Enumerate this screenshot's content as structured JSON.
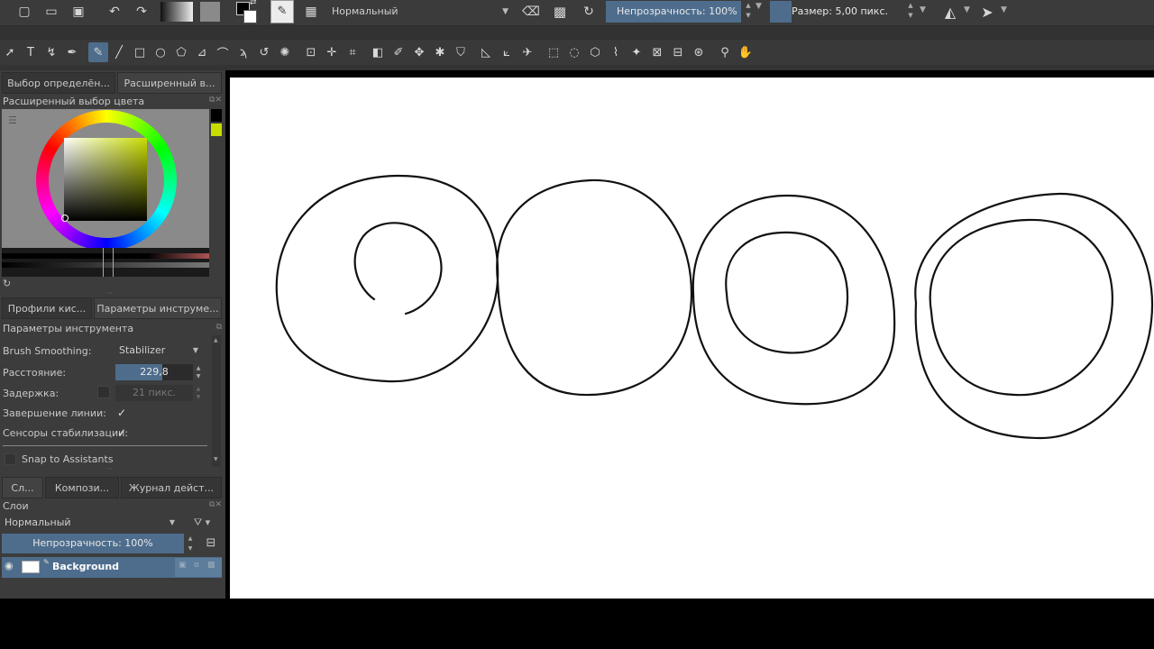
{
  "toolbar": {
    "blend_mode": "Нормальный",
    "opacity": "Непрозрачность: 100%",
    "size": "Размер: 5,00 пикс."
  },
  "tabs_top": [
    "Выбор определён...",
    "Расширенный в..."
  ],
  "color_panel": {
    "title": "Расширенный выбор цвета"
  },
  "tabs_mid": [
    "Профили кис...",
    "Параметры инструме..."
  ],
  "tool_options": {
    "title": "Параметры инструмента",
    "smoothing_label": "Brush Smoothing:",
    "smoothing_value": "Stabilizer",
    "distance_label": "Расстояние:",
    "distance_value": "229,8",
    "delay_label": "Задержка:",
    "delay_value": "21 пикс.",
    "finish_label": "Завершение линии:",
    "sensors_label": "Сенсоры стабилизации:",
    "snap_label": "Snap to Assistants"
  },
  "tabs_bottom": [
    "Сл...",
    "Компози...",
    "Журнал дейст..."
  ],
  "layers": {
    "title": "Слои",
    "blend_mode": "Нормальный",
    "opacity": "Непрозрачность:  100%",
    "layer_name": "Background"
  },
  "colors": {
    "accent": "#4e6d8d",
    "foreground_swatch": "#000000",
    "background_swatch": "#c8dc00"
  }
}
